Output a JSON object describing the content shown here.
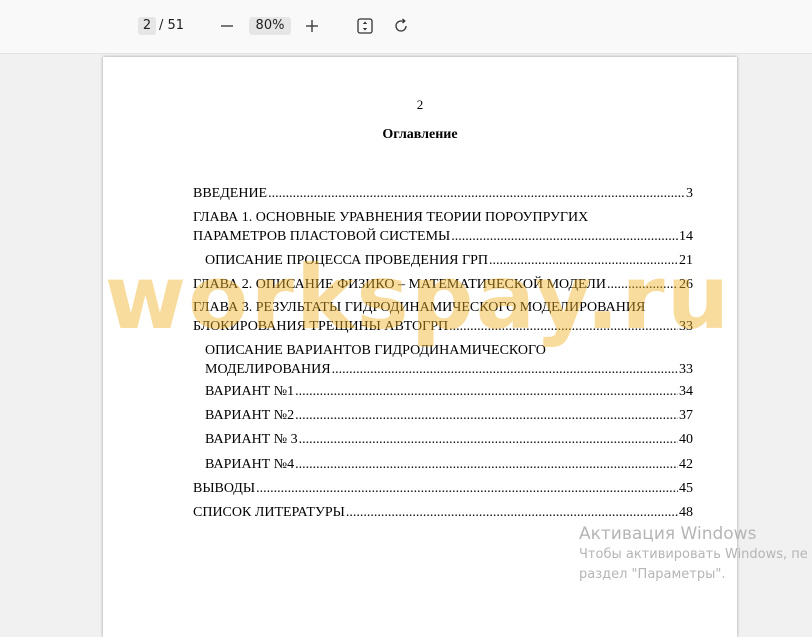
{
  "toolbar": {
    "page_current": "2",
    "page_total": "/ 51",
    "zoom_level": "80%",
    "icons": {
      "zoom_out": "minus-icon",
      "zoom_in": "plus-icon",
      "fit_page": "fit-page-icon",
      "rotate": "rotate-icon"
    }
  },
  "document": {
    "page_number": "2",
    "toc_title": "Оглавление",
    "toc": [
      {
        "text": "ВВЕДЕНИЕ",
        "page": "3"
      },
      {
        "text": "ГЛАВА 1. ОСНОВНЫЕ УРАВНЕНИЯ ТЕОРИИ ПОРОУПРУГИХ",
        "text2": "ПАРАМЕТРОВ ПЛАСТОВОЙ СИСТЕМЫ",
        "page": "14"
      },
      {
        "text": "Описание процесса проведения ГРП",
        "page": "21"
      },
      {
        "text": "ГЛАВА 2. ОПИСАНИЕ ФИЗИКО – МАТЕМАТИЧЕСКОЙ МОДЕЛИ",
        "page": "26"
      },
      {
        "text": "ГЛАВА 3. РЕЗУЛЬТАТЫ ГИДРОДИНАМИЧЕСКОГО МОДЕЛИРОВАНИЯ",
        "text2": "БЛОКИРОВАНИЯ ТРЕЩИНЫ АВТОГРП",
        "page": "33"
      },
      {
        "text": "Описание вариантов гидродинамического",
        "text2": "моделирования",
        "page": "33"
      },
      {
        "text": "Вариант №1",
        "page": "34"
      },
      {
        "text": "Вариант №2",
        "page": "37"
      },
      {
        "text": "Вариант № 3",
        "page": "40"
      },
      {
        "text": "Вариант №4",
        "page": "42"
      },
      {
        "text": "ВЫВОДЫ",
        "page": "45"
      },
      {
        "text": "СПИСОК ЛИТЕРАТУРЫ",
        "page": "48"
      }
    ]
  },
  "watermark": "workspay.ru",
  "activation": {
    "title": "Активация Windows",
    "line1": "Чтобы активировать Windows, пе",
    "line2": "раздел \"Параметры\"."
  }
}
